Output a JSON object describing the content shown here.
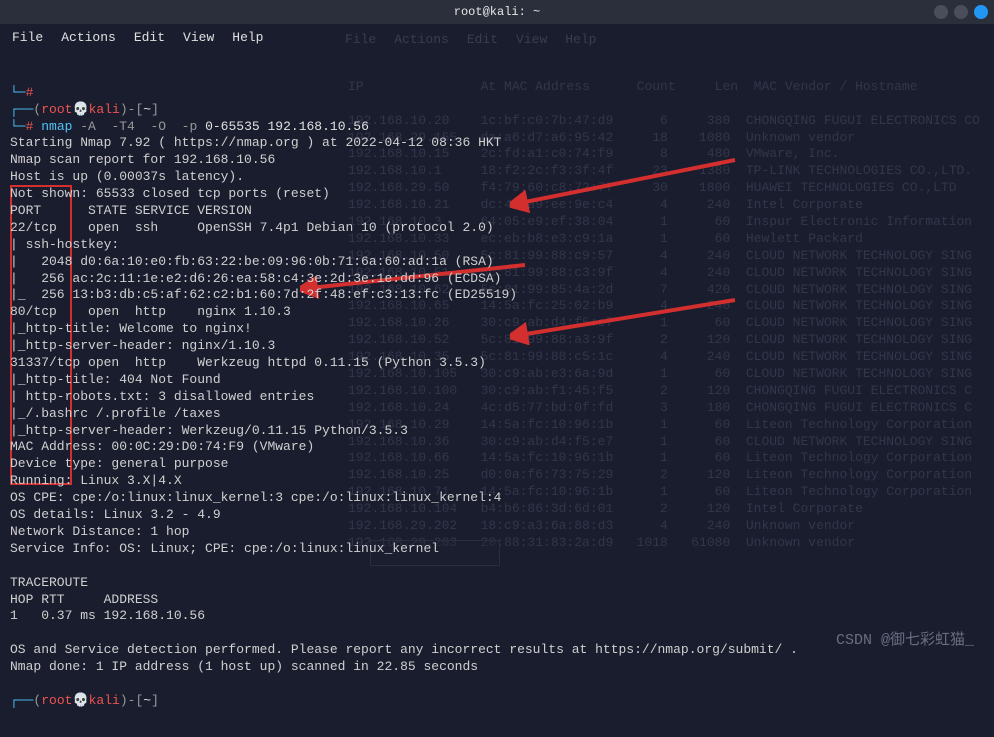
{
  "titlebar": {
    "title": "root@kali: ~"
  },
  "menubar": {
    "file": "File",
    "actions": "Actions",
    "edit": "Edit",
    "view": "View",
    "help": "Help"
  },
  "ghost_menubar": {
    "file": "File",
    "actions": "Actions",
    "edit": "Edit",
    "view": "View",
    "help": "Help"
  },
  "ghost_header": "IP               At MAC Address      Count     Len  MAC Vendor / Hostname",
  "ghost_rows": [
    "192.168.10.20    1c:bf:c0:7b:47:d9      6     380  CHONGQING FUGUI ELECTRONICS CO",
    "192.168.29.155   da:a6:d7:a6:95:42     18    1080  Unknown vendor",
    "192.168.10.15    2c:fd:a1:c0:74:f9      8     480  VMware, Inc.",
    "192.168.10.1     18:f2:2c:f3:3f:4f     23    1380  TP-LINK TECHNOLOGIES CO.,LTD.",
    "192.168.29.50    f4:79:60:c8:72:77     30    1800  HUAWEI TECHNOLOGIES CO.,LTD",
    "192.168.10.21    dc:41:a9:ee:9e:c4      4     240  Intel Corporate",
    "192.168.10.3     64:05:e9:ef:38:04      1      60  Inspur Electronic Information",
    "192.168.10.33    ec:eb:b8:e3:c9:1a      1      60  Hewlett Packard",
    "192.168.10.50    5c:81:99:88:c9:57      4     240  CLOUD NETWORK TECHNOLOGY SING",
    "192.168.10.51    5c:81:99:88:c3:9f      4     240  CLOUD NETWORK TECHNOLOGY SING",
    "192.168.10.62    5c:81:99:85:4a:2d      7     420  CLOUD NETWORK TECHNOLOGY SING",
    "192.168.10.65    14:5a:fc:25:02:b9      4     240  CLOUD NETWORK TECHNOLOGY SING",
    "192.168.10.26    30:c9:ab:d4:f5:e7      1      60  CLOUD NETWORK TECHNOLOGY SING",
    "192.168.10.52    5c:81:99:88:a3:9f      2     120  CLOUD NETWORK TECHNOLOGY SING",
    "192.168.10.35    5c:81:99:88:c5:1c      4     240  CLOUD NETWORK TECHNOLOGY SING",
    "192.168.10.105   30:c9:ab:e3:6a:9d      1      60  CLOUD NETWORK TECHNOLOGY SING",
    "192.168.10.100   30:c9:ab:f1:45:f5      2     120  CHONGQING FUGUI ELECTRONICS C",
    "192.168.10.24    4c:d5:77:bd:0f:fd      3     180  CHONGQING FUGUI ELECTRONICS C",
    "192.168.10.29    14:5a:fc:10:96:1b      1      60  Liteon Technology Corporation",
    "192.168.10.36    30:c9:ab:d4:f5:e7      1      60  CLOUD NETWORK TECHNOLOGY SING",
    "192.168.10.66    14:5a:fc:10:96:1b      1      60  Liteon Technology Corporation",
    "192.168.10.25    d0:0a:f6:73:75:29      2     120  Liteon Technology Corporation",
    "192.168.10.71    14:5a:fc:10:96:1b      1      60  Liteon Technology Corporation",
    "192.168.10.104   b4:b6:86:3d:6d:01      2     120  Intel Corporate",
    "192.168.29.202   18:c9:a3:6a:88:d3      4     240  Unknown vendor",
    "192.168.29.203   20:88:31:83:2a:d9   1018   61080  Unknown vendor"
  ],
  "prompt": {
    "open_paren": "(",
    "user": "root",
    "at": "@",
    "host": "kali",
    "close_paren": ")-[",
    "path": "~",
    "end": "]",
    "hash1": "#",
    "hash2": "#",
    "lcorner": "└─"
  },
  "cmd": {
    "nmap": "nmap",
    "flags": " -A  -T4  -O  -p",
    "args": " 0-65535 192.168.10.56"
  },
  "out": {
    "l1": "Starting Nmap 7.92 ( https://nmap.org ) at 2022-04-12 08:36 HKT",
    "l2": "Nmap scan report for 192.168.10.56",
    "l3": "Host is up (0.00037s latency).",
    "l4": "Not shown: 65533 closed tcp ports (reset)",
    "l5": "PORT      STATE SERVICE VERSION",
    "l6": "22/tcp    open  ssh     OpenSSH 7.4p1 Debian 10 (protocol 2.0)",
    "l7": "| ssh-hostkey: ",
    "l8": "|   2048 d0:6a:10:e0:fb:63:22:be:09:96:0b:71:6a:60:ad:1a (RSA)",
    "l9": "|   256 ac:2c:11:1e:e2:d6:26:ea:58:c4:3e:2d:3e:1e:dd:96 (ECDSA)",
    "l10": "|_  256 13:b3:db:c5:af:62:c2:b1:60:7d:2f:48:ef:c3:13:fc (ED25519)",
    "l11": "80/tcp    open  http    nginx 1.10.3",
    "l12": "|_http-title: Welcome to nginx!",
    "l13": "|_http-server-header: nginx/1.10.3",
    "l14": "31337/tcp open  http    Werkzeug httpd 0.11.15 (Python 3.5.3)",
    "l15": "|_http-title: 404 Not Found",
    "l16": "| http-robots.txt: 3 disallowed entries ",
    "l17": "|_/.bashrc /.profile /taxes",
    "l18": "|_http-server-header: Werkzeug/0.11.15 Python/3.5.3",
    "l19": "MAC Address: 00:0C:29:D0:74:F9 (VMware)",
    "l20": "Device type: general purpose",
    "l21": "Running: Linux 3.X|4.X",
    "l22": "OS CPE: cpe:/o:linux:linux_kernel:3 cpe:/o:linux:linux_kernel:4",
    "l23": "OS details: Linux 3.2 - 4.9",
    "l24": "Network Distance: 1 hop",
    "l25": "Service Info: OS: Linux; CPE: cpe:/o:linux:linux_kernel",
    "l26": "",
    "l27": "TRACEROUTE",
    "l28": "HOP RTT     ADDRESS",
    "l29": "1   0.37 ms 192.168.10.56",
    "l30": "",
    "l31": "OS and Service detection performed. Please report any incorrect results at https://nmap.org/submit/ .",
    "l32": "Nmap done: 1 IP address (1 host up) scanned in 22.85 seconds"
  },
  "watermark": "CSDN @御七彩虹猫_"
}
